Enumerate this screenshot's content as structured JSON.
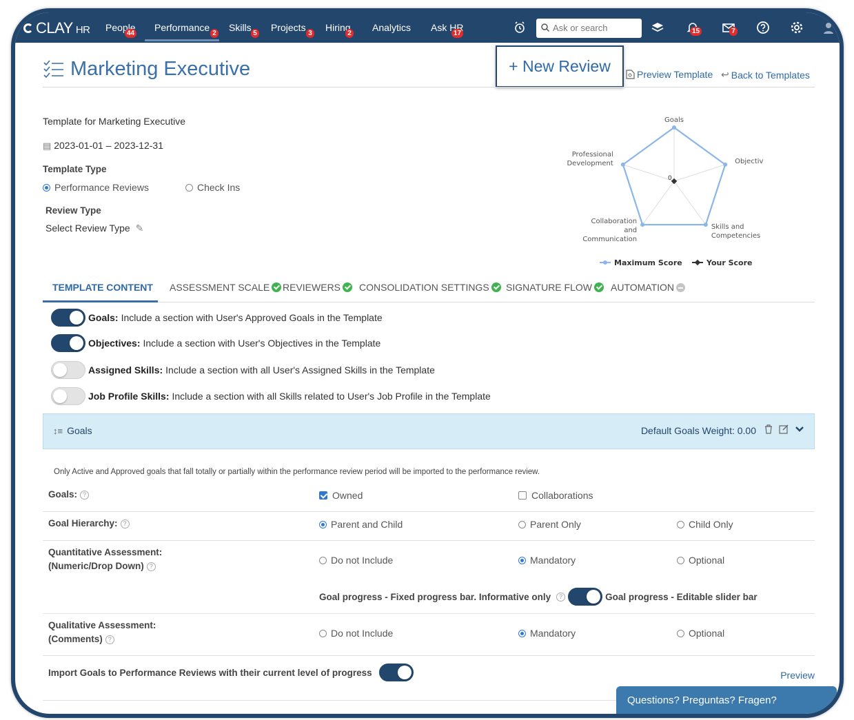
{
  "app": {
    "logo_main": "CLAY",
    "logo_sub": "HR"
  },
  "nav": {
    "items": [
      {
        "label": "People",
        "badge": "44"
      },
      {
        "label": "Performance",
        "badge": "2"
      },
      {
        "label": "Skills",
        "badge": "5"
      },
      {
        "label": "Projects",
        "badge": "3"
      },
      {
        "label": "Hiring",
        "badge": "2"
      },
      {
        "label": "Analytics",
        "badge": ""
      },
      {
        "label": "Ask HR",
        "badge": "17"
      }
    ],
    "search_placeholder": "Ask or search",
    "notifications_badge": "15",
    "messages_badge": "7"
  },
  "header": {
    "title": "Marketing Executive",
    "new_review": "+ New Review",
    "preview_template": "Preview Template",
    "back_to_templates": "Back to Templates"
  },
  "meta": {
    "description": "Template for Marketing Executive",
    "date_range": "2023-01-01 – 2023-12-31",
    "template_type_label": "Template Type",
    "template_type_options": [
      "Performance Reviews",
      "Check Ins"
    ],
    "template_type_selected": "Performance Reviews",
    "review_type_label": "Review Type",
    "review_type_value": "Select Review Type"
  },
  "chart_data": {
    "type": "radar",
    "axes": [
      "Goals",
      "Objectives",
      "Skills and Competencies",
      "Collaboration and Communication",
      "Professional Development"
    ],
    "series": [
      {
        "name": "Maximum Score",
        "values": [
          1,
          1,
          1,
          1,
          1
        ],
        "color": "#8ab6e8"
      },
      {
        "name": "Your Score",
        "values": [
          0,
          0,
          0,
          0,
          0
        ],
        "color": "#333333"
      }
    ],
    "center_label": "0",
    "legend_position": "bottom"
  },
  "tabs": [
    {
      "label": "TEMPLATE CONTENT",
      "status": "active"
    },
    {
      "label": "ASSESSMENT SCALE",
      "status": "complete"
    },
    {
      "label": "REVIEWERS",
      "status": "complete"
    },
    {
      "label": "CONSOLIDATION SETTINGS",
      "status": "complete"
    },
    {
      "label": "SIGNATURE FLOW",
      "status": "complete"
    },
    {
      "label": "AUTOMATION",
      "status": "pending"
    }
  ],
  "sections": [
    {
      "name": "Goals:",
      "desc": "Include a section with User's Approved Goals in the Template",
      "on": true
    },
    {
      "name": "Objectives:",
      "desc": "Include a section with User's Objectives in the Template",
      "on": true
    },
    {
      "name": "Assigned Skills:",
      "desc": "Include a section with all User's Assigned Skills in the Template",
      "on": false
    },
    {
      "name": "Job Profile Skills:",
      "desc": "Include a section with all Skills related to User's Job Profile in the Template",
      "on": false
    }
  ],
  "goals_panel": {
    "title": "Goals",
    "weight_label": "Default Goals Weight: 0.00",
    "note": "Only Active and Approved goals that fall totally or partially within the performance review period will be imported to the performance review.",
    "goals_label": "Goals:",
    "goals_options": [
      "Owned",
      "Collaborations"
    ],
    "goals_checked": [
      "Owned"
    ],
    "hierarchy_label": "Goal Hierarchy:",
    "hierarchy_options": [
      "Parent and Child",
      "Parent Only",
      "Child Only"
    ],
    "hierarchy_selected": "Parent and Child",
    "quant_label_1": "Quantitative Assessment:",
    "quant_label_2": "(Numeric/Drop Down)",
    "quant_options": [
      "Do not Include",
      "Mandatory",
      "Optional"
    ],
    "quant_selected": "Mandatory",
    "progress_left": "Goal progress - Fixed progress bar. Informative only",
    "progress_right": "Goal progress - Editable slider bar",
    "progress_toggle_on": true,
    "qual_label_1": "Qualitative Assessment:",
    "qual_label_2": "(Comments)",
    "qual_options": [
      "Do not Include",
      "Mandatory",
      "Optional"
    ],
    "qual_selected": "Mandatory",
    "import_label": "Import Goals to Performance Reviews with their current level of progress",
    "import_on": true,
    "preview": "Preview"
  },
  "chat": {
    "label": "Questions? Preguntas? Fragen?"
  },
  "colors": {
    "nav": "#23466d",
    "accent": "#3a6fa8",
    "ok": "#3fb34f",
    "badge": "#e02c2c"
  }
}
